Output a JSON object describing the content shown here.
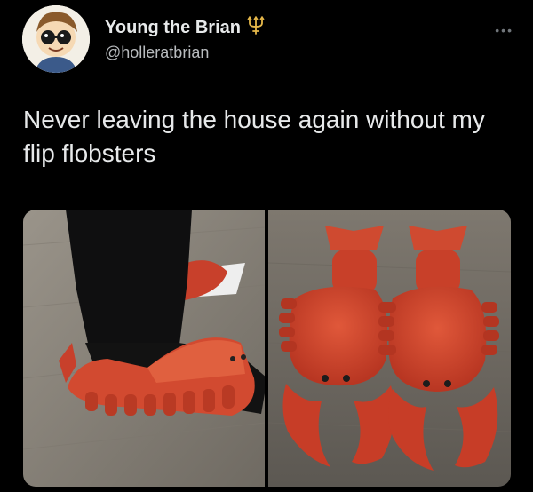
{
  "author": {
    "display_name": "Young the Brian",
    "handle": "@holleratbrian",
    "badge_icon": "trident-icon"
  },
  "tweet": {
    "text": "Never leaving the house again without my flip flobsters"
  },
  "menu": {
    "icon": "more-options-icon",
    "glyph": "•••"
  },
  "media": [
    {
      "name": "photo-lobster-slippers-worn",
      "icon": "photo"
    },
    {
      "name": "photo-lobster-slippers-pair",
      "icon": "photo"
    }
  ],
  "colors": {
    "background": "#000000",
    "text": "#e7e9ea",
    "secondary_text": "#b9bcbf",
    "lobster_red": "#d8462e",
    "floor_wood": "#8c857a"
  }
}
